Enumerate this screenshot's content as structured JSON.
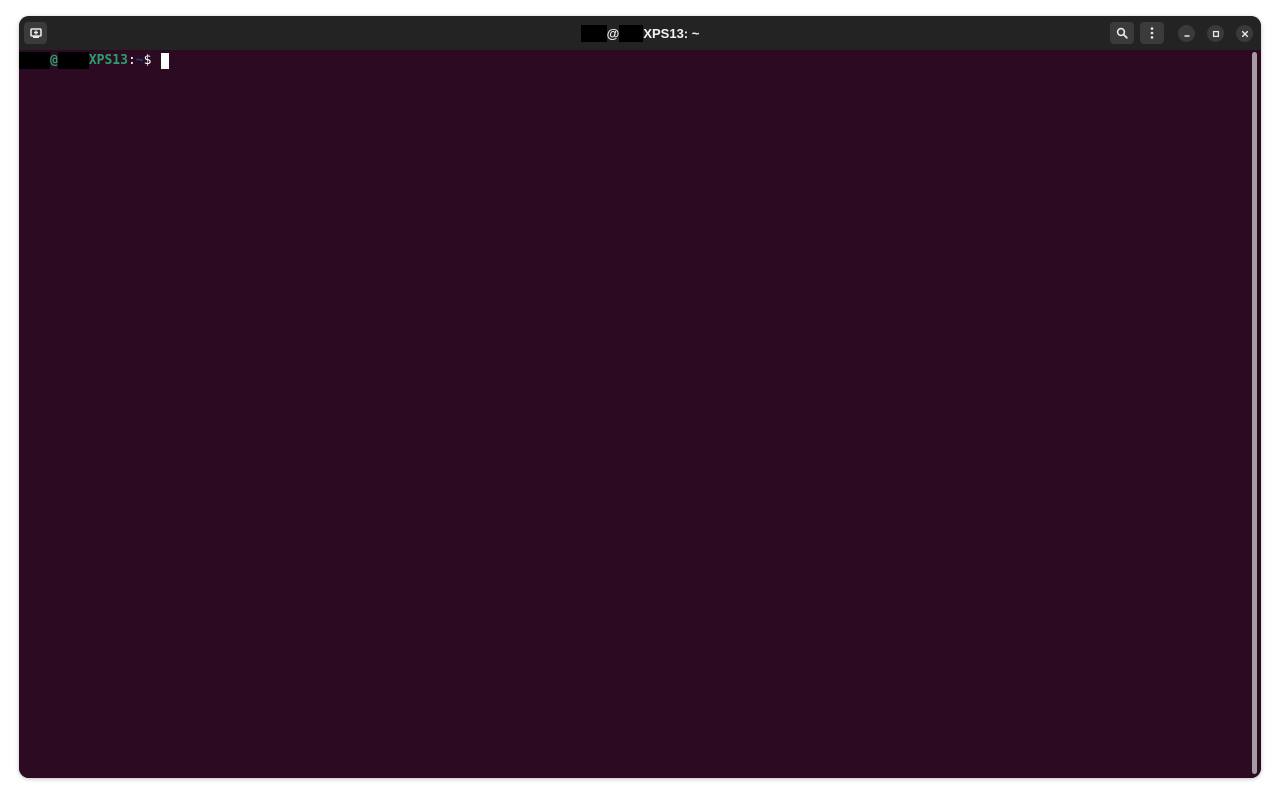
{
  "window": {
    "title_at": "@",
    "title_host": "XPS13: ~"
  },
  "terminal": {
    "prompt_at": "@",
    "prompt_host": "XPS13",
    "prompt_sep": ":",
    "prompt_path": "~",
    "prompt_dollar": "$ "
  },
  "icons": {
    "new_tab": "new-tab-icon",
    "search": "search-icon",
    "menu": "kebab-menu-icon",
    "minimize": "minimize-icon",
    "maximize": "maximize-icon",
    "close": "close-icon"
  },
  "colors": {
    "terminal_background": "#2c0a22",
    "titlebar_background": "#232323",
    "prompt_user_host": "#26a269",
    "prompt_path": "#12488b",
    "text": "#ffffff"
  }
}
